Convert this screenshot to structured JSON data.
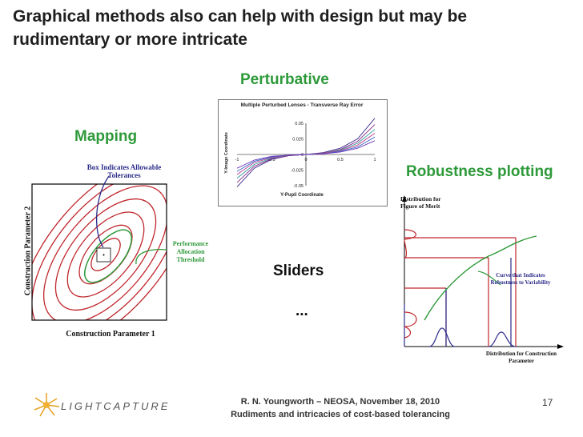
{
  "slide": {
    "title": "Graphical methods also can help with design but may be rudimentary or more intricate",
    "page_number": "17"
  },
  "labels": {
    "perturbative": "Perturbative",
    "mapping": "Mapping",
    "robustness": "Robustness plotting",
    "sliders": "Sliders",
    "ellipsis": "..."
  },
  "mapping_figure": {
    "box_note": "Box Indicates Allowable Tolerances",
    "threshold_note": "Performance Allocation Threshold",
    "x_axis_label": "Construction Parameter 1",
    "y_axis_label": "Construction Parameter 2",
    "colors": {
      "contour": "#c0262c",
      "threshold": "#2e9a3a",
      "tolerance": "#2b2b8a"
    }
  },
  "perturbative_chart": {
    "chart_data": {
      "type": "line",
      "title": "Multiple Perturbed Lenses - Transverse Ray Error",
      "xlabel": "Y-Pupil Coordinate",
      "ylabel": "Y-Image Coordinate",
      "xlim": [
        -1,
        1
      ],
      "ylim": [
        -0.05,
        0.05
      ],
      "x_ticks": [
        "-1",
        "-0.5",
        "0",
        "0.5",
        "1"
      ],
      "y_ticks": [
        "0.05",
        "0.025",
        "0",
        "-0.025",
        "-0.05"
      ],
      "x": [
        -1,
        -0.75,
        -0.5,
        -0.25,
        0,
        0.25,
        0.5,
        0.75,
        1
      ],
      "series": [
        {
          "color": "#3a2a8a",
          "values": [
            -0.052,
            -0.022,
            -0.008,
            -0.002,
            0,
            0.003,
            0.01,
            0.025,
            0.058
          ]
        },
        {
          "color": "#8a2a8a",
          "values": [
            -0.045,
            -0.019,
            -0.007,
            -0.002,
            0,
            0.002,
            0.008,
            0.021,
            0.048
          ]
        },
        {
          "color": "#2a9a9a",
          "values": [
            -0.038,
            -0.016,
            -0.006,
            -0.001,
            0,
            0.002,
            0.007,
            0.018,
            0.04
          ]
        },
        {
          "color": "#c03a8a",
          "values": [
            -0.032,
            -0.013,
            -0.005,
            -0.001,
            0,
            0.002,
            0.006,
            0.015,
            0.034
          ]
        },
        {
          "color": "#3a6aca",
          "values": [
            -0.027,
            -0.011,
            -0.004,
            -0.001,
            0,
            0.001,
            0.005,
            0.012,
            0.028
          ]
        },
        {
          "color": "#6a3aba",
          "values": [
            -0.022,
            -0.009,
            -0.003,
            -0.001,
            0,
            0.001,
            0.004,
            0.01,
            0.022
          ]
        }
      ]
    }
  },
  "robustness_figure": {
    "y_dist_label": "Distribution for Figure of Merit",
    "curve_note": "Curve that Indicates Robustness to Variability",
    "x_dist_label": "Distribution for Construction Parameter",
    "colors": {
      "lines": "#c0262c",
      "curve": "#2e9a3a",
      "distribution": "#2b2b8a"
    }
  },
  "footer": {
    "line1": "R. N. Youngworth – NEOSA, November 18, 2010",
    "line2": "Rudiments and intricacies of cost-based tolerancing",
    "logo": "LIGHTCAPTURE"
  }
}
